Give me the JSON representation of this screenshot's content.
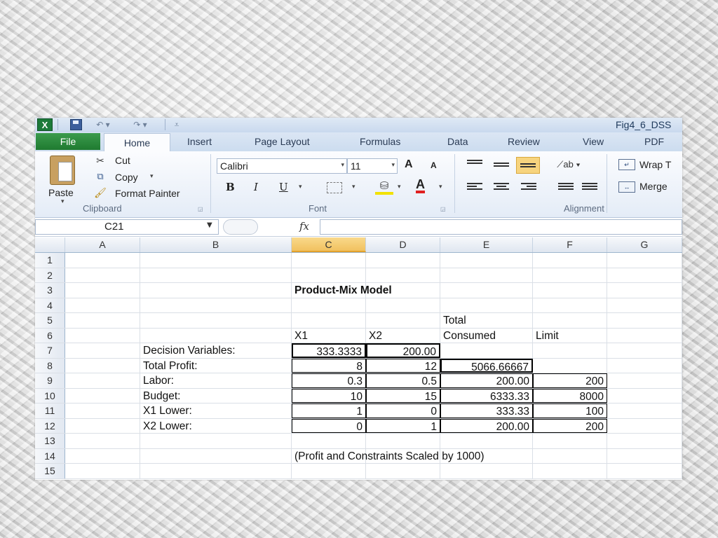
{
  "window": {
    "title": "Fig4_6_DSS",
    "app_icon": "X"
  },
  "tabs": [
    "File",
    "Home",
    "Insert",
    "Page Layout",
    "Formulas",
    "Data",
    "Review",
    "View",
    "PDF"
  ],
  "ribbon": {
    "clipboard": {
      "label": "Clipboard",
      "paste": "Paste",
      "cut": "Cut",
      "copy": "Copy",
      "format_painter": "Format Painter"
    },
    "font": {
      "label": "Font",
      "font_name": "Calibri",
      "font_size": "11",
      "bold": "B",
      "italic": "I",
      "underline": "U",
      "grow": "A",
      "shrink": "A",
      "font_color_letter": "A"
    },
    "alignment": {
      "label": "Alignment",
      "wrap_text": "Wrap T",
      "merge": "Merge"
    }
  },
  "formula_bar": {
    "name_box": "C21",
    "fx": "fx",
    "value": ""
  },
  "columns": [
    "A",
    "B",
    "C",
    "D",
    "E",
    "F",
    "G"
  ],
  "selected_column": "C",
  "rows": [
    {
      "n": "1"
    },
    {
      "n": "2"
    },
    {
      "n": "3",
      "C": "Product-Mix Model"
    },
    {
      "n": "4"
    },
    {
      "n": "5",
      "E": "Total"
    },
    {
      "n": "6",
      "C": "X1",
      "D": "X2",
      "E": "Consumed",
      "F": "Limit"
    },
    {
      "n": "7",
      "B": "Decision Variables:",
      "C": "333.3333",
      "D": "200.00"
    },
    {
      "n": "8",
      "B": "Total Profit:",
      "C": "8",
      "D": "12",
      "E": "5066.66667"
    },
    {
      "n": "9",
      "B": "Labor:",
      "C": "0.3",
      "D": "0.5",
      "E": "200.00",
      "F": "200"
    },
    {
      "n": "10",
      "B": "Budget:",
      "C": "10",
      "D": "15",
      "E": "6333.33",
      "F": "8000"
    },
    {
      "n": "11",
      "B": "X1 Lower:",
      "C": "1",
      "D": "0",
      "E": "333.33",
      "F": "100"
    },
    {
      "n": "12",
      "B": "X2 Lower:",
      "C": "0",
      "D": "1",
      "E": "200.00",
      "F": "200"
    },
    {
      "n": "13"
    },
    {
      "n": "14",
      "C": "(Profit and Constraints Scaled by 1000)"
    },
    {
      "n": "15"
    }
  ]
}
